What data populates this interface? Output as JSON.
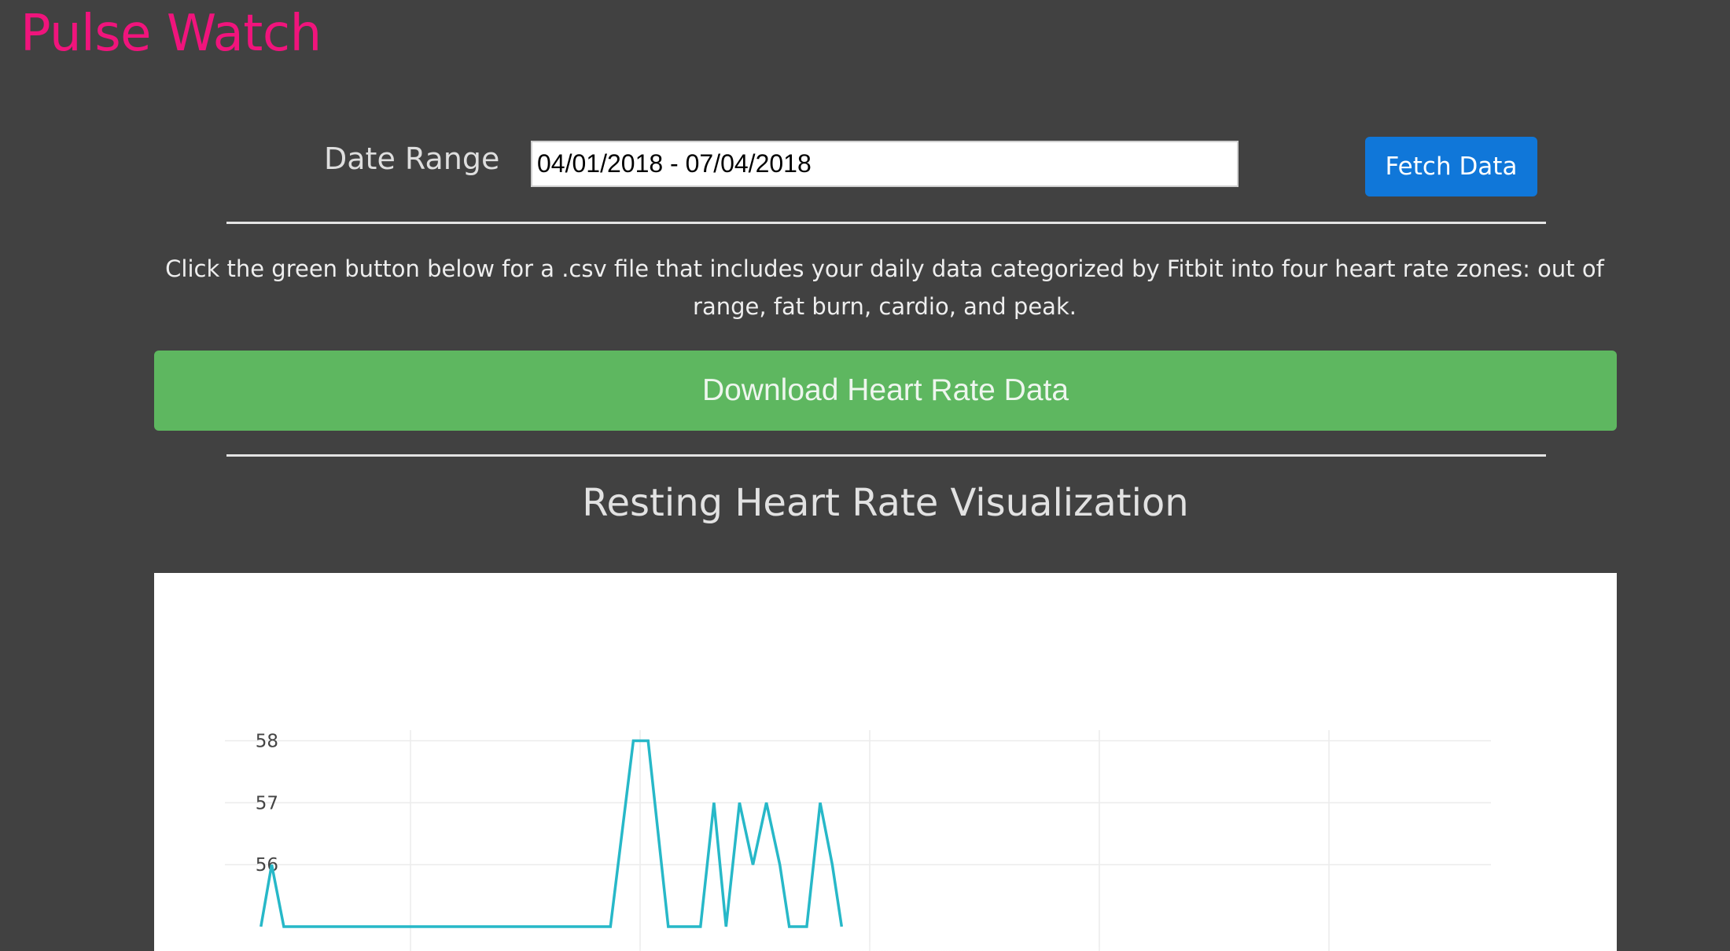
{
  "app": {
    "title": "Pulse Watch"
  },
  "controls": {
    "date_range_label": "Date Range",
    "date_range_value": "04/01/2018 - 07/04/2018",
    "fetch_button_label": "Fetch Data"
  },
  "download": {
    "instructions": "Click the green button below for a .csv file that includes your daily data categorized by Fitbit into four heart rate zones: out of range, fat burn, cardio, and peak.",
    "button_label": "Download Heart Rate Data"
  },
  "visualization": {
    "title": "Resting Heart Rate Visualization"
  },
  "colors": {
    "background": "#414141",
    "title_accent": "#f0147c",
    "fetch_button": "#1077d9",
    "download_button": "#5eb760",
    "series_line": "#27b8c8"
  },
  "chart_data": {
    "type": "line",
    "title": "",
    "xlabel": "",
    "ylabel": "",
    "y_ticks": [
      56,
      57,
      58
    ],
    "x_gridline_count": 5,
    "grid": true,
    "ylim": [
      55,
      58.45
    ],
    "xlim": [
      0,
      95
    ],
    "series": [
      {
        "values": [
          {
            "x": 3.5,
            "y": 55
          },
          {
            "x": 4.3,
            "y": 56
          },
          {
            "x": 5.2,
            "y": 55
          },
          {
            "x": 29.5,
            "y": 55
          },
          {
            "x": 31.2,
            "y": 58
          },
          {
            "x": 32.3,
            "y": 58
          },
          {
            "x": 33.8,
            "y": 55
          },
          {
            "x": 36.2,
            "y": 55
          },
          {
            "x": 37.2,
            "y": 57
          },
          {
            "x": 38.1,
            "y": 55
          },
          {
            "x": 39.1,
            "y": 57
          },
          {
            "x": 40.1,
            "y": 56
          },
          {
            "x": 41.1,
            "y": 57
          },
          {
            "x": 42.1,
            "y": 56
          },
          {
            "x": 42.8,
            "y": 55
          },
          {
            "x": 44.1,
            "y": 55
          },
          {
            "x": 45.1,
            "y": 57
          },
          {
            "x": 46.0,
            "y": 56
          },
          {
            "x": 46.7,
            "y": 55
          }
        ]
      }
    ]
  }
}
